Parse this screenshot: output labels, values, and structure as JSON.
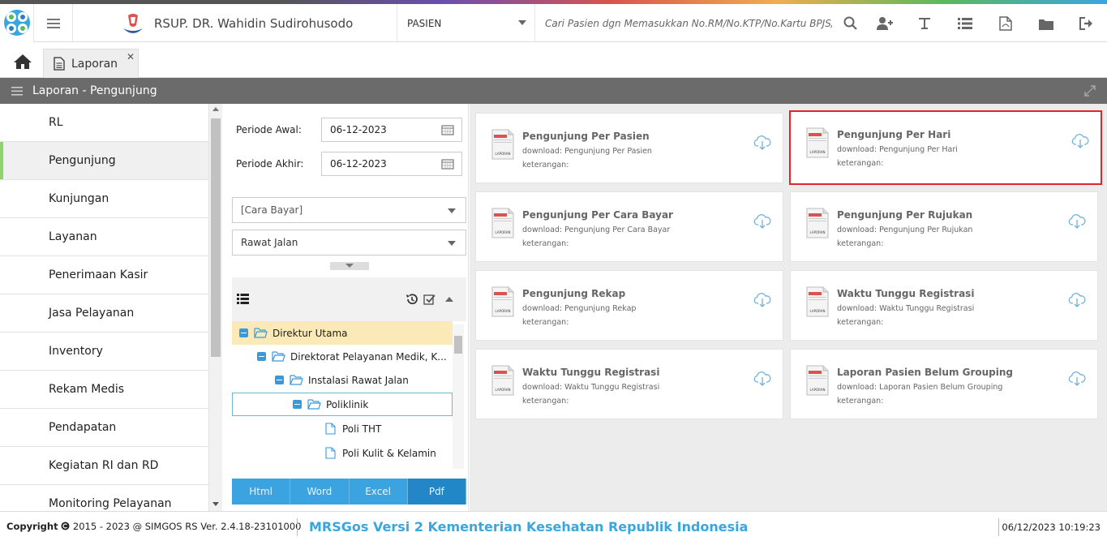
{
  "colors": {
    "accent": "#3ba3df",
    "titlebar": "#6b6b6b",
    "active_nav": "#8cd46c",
    "highlight_border": "#e02626",
    "footer_brand": "#39a6de"
  },
  "header": {
    "hospital_name": "RSUP. DR. Wahidin Sudirohusodo",
    "search_type": "PASIEN",
    "search_placeholder": "Cari Pasien dgn Memasukkan No.RM/No.KTP/No.Kartu BPJS/",
    "icons": [
      "search-icon",
      "add-user-icon",
      "text-icon",
      "list-icon",
      "pdf-file-icon",
      "folder-icon",
      "logout-icon"
    ]
  },
  "tabs": [
    {
      "label": "Laporan"
    }
  ],
  "titlebar": {
    "title": "Laporan - Pengunjung"
  },
  "nav": {
    "items": [
      {
        "label": "RL"
      },
      {
        "label": "Pengunjung",
        "active": true
      },
      {
        "label": "Kunjungan"
      },
      {
        "label": "Layanan"
      },
      {
        "label": "Penerimaan Kasir"
      },
      {
        "label": "Jasa Pelayanan"
      },
      {
        "label": "Inventory"
      },
      {
        "label": "Rekam Medis"
      },
      {
        "label": "Pendapatan"
      },
      {
        "label": "Kegiatan RI dan RD"
      },
      {
        "label": "Monitoring Pelayanan"
      }
    ]
  },
  "filters": {
    "periode_awal_label": "Periode Awal:",
    "periode_awal": "06-12-2023",
    "periode_akhir_label": "Periode Akhir:",
    "periode_akhir": "06-12-2023",
    "cara_bayar_placeholder": "[Cara Bayar]",
    "jenis": "Rawat Jalan"
  },
  "tree": {
    "nodes": [
      {
        "label": "Direktur Utama",
        "type": "folder",
        "highlighted": true
      },
      {
        "label": "Direktorat Pelayanan Medik, K...",
        "type": "folder"
      },
      {
        "label": "Instalasi Rawat Jalan",
        "type": "folder"
      },
      {
        "label": "Poliklinik",
        "type": "folder",
        "selected": true
      },
      {
        "label": "Poli THT",
        "type": "file"
      },
      {
        "label": "Poli Kulit & Kelamin",
        "type": "file"
      }
    ]
  },
  "export": {
    "buttons": [
      {
        "label": "Html"
      },
      {
        "label": "Word"
      },
      {
        "label": "Excel"
      },
      {
        "label": "Pdf",
        "active": true
      }
    ]
  },
  "cards": [
    {
      "title": "Pengunjung Per Pasien",
      "download": "download: Pengunjung Per Pasien",
      "keterangan": "keterangan:"
    },
    {
      "title": "Pengunjung Per Hari",
      "download": "download: Pengunjung Per Hari",
      "keterangan": "keterangan:",
      "highlighted": true
    },
    {
      "title": "Pengunjung Per Cara Bayar",
      "download": "download: Pengunjung Per Cara Bayar",
      "keterangan": "keterangan:"
    },
    {
      "title": "Pengunjung Per Rujukan",
      "download": "download: Pengunjung Per Rujukan",
      "keterangan": "keterangan:"
    },
    {
      "title": "Pengunjung Rekap",
      "download": "download: Pengunjung Rekap",
      "keterangan": "keterangan:"
    },
    {
      "title": "Waktu Tunggu Registrasi",
      "download": "download: Waktu Tunggu Registrasi",
      "keterangan": "keterangan:"
    },
    {
      "title": "Waktu Tunggu Registrasi",
      "download": "download: Waktu Tunggu Registrasi",
      "keterangan": "keterangan:"
    },
    {
      "title": "Laporan Pasien Belum Grouping",
      "download": "download: Laporan Pasien Belum Grouping",
      "keterangan": "keterangan:"
    }
  ],
  "pdf_icon_caption": "LAPORAN",
  "footer": {
    "copyright_label": "Copyright",
    "copyright_text": "2015 - 2023 @ SIMGOS RS Ver. 2.4.18-23101000",
    "brand": "MRSGos Versi 2 Kementerian Kesehatan Republik Indonesia",
    "datetime": "06/12/2023 10:19:23"
  }
}
